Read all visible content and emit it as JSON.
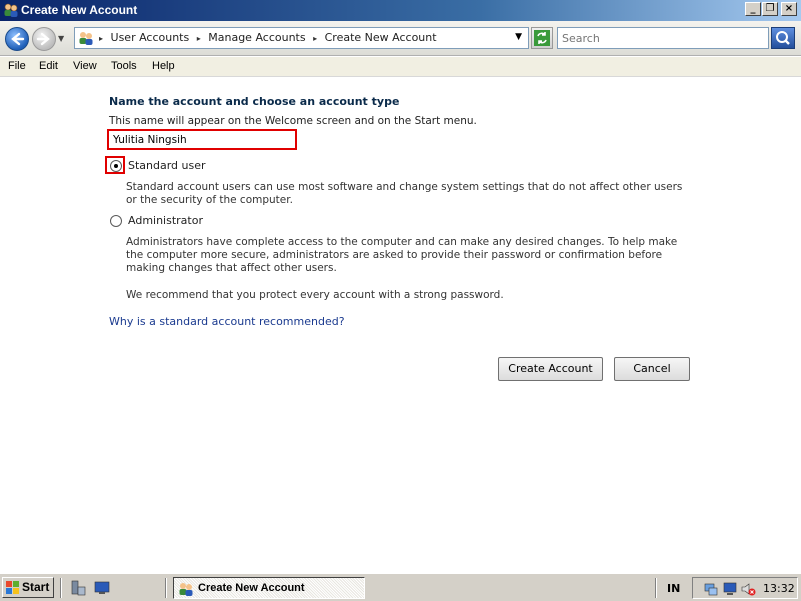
{
  "window": {
    "title": "Create New Account"
  },
  "address_bar": {
    "crumbs": [
      "User Accounts",
      "Manage Accounts",
      "Create New Account"
    ],
    "search_placeholder": "Search"
  },
  "menu": {
    "items": [
      "File",
      "Edit",
      "View",
      "Tools",
      "Help"
    ]
  },
  "form": {
    "heading": "Name the account and choose an account type",
    "subtext": "This name will appear on the Welcome screen and on the Start menu.",
    "account_name": "Yulitia Ningsih",
    "options": [
      {
        "label": "Standard user",
        "checked": true,
        "description": "Standard account users can use most software and change system settings that do not affect other users or the security of the computer."
      },
      {
        "label": "Administrator",
        "checked": false,
        "description": "Administrators have complete access to the computer and can make any desired changes. To help make the computer more secure, administrators are asked to provide their password or confirmation before making changes that affect other users."
      }
    ],
    "recommendation": "We recommend that you protect every account with a strong password.",
    "help_link": "Why is a standard account recommended?",
    "create_button": "Create Account",
    "cancel_button": "Cancel"
  },
  "taskbar": {
    "start_label": "Start",
    "task_label": "Create New Account",
    "language": "IN",
    "clock": "13:32"
  },
  "colors": {
    "highlight": "#e00000",
    "link": "#1a3a8f",
    "heading": "#0a2a4a"
  }
}
